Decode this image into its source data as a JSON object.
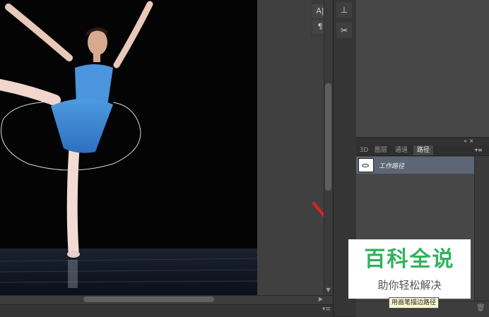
{
  "panel_tabs": [
    "3D",
    "图层",
    "通道",
    "路径"
  ],
  "active_tab": "路径",
  "path_item": "工作路径",
  "tooltip": "用画笔描边路径",
  "watermark": {
    "main": "百科全说",
    "sub": "助你轻松解决"
  },
  "icons": {
    "character_panel": "character-icon",
    "paragraph_panel": "paragraph-icon",
    "clone_source": "clone-source-icon",
    "tool_presets": "tool-presets-icon",
    "delete": "trash-icon"
  },
  "colors": {
    "active_row": "#5c6675",
    "watermark_green": "#2fb35a",
    "annotation_arrow": "#e02020"
  }
}
